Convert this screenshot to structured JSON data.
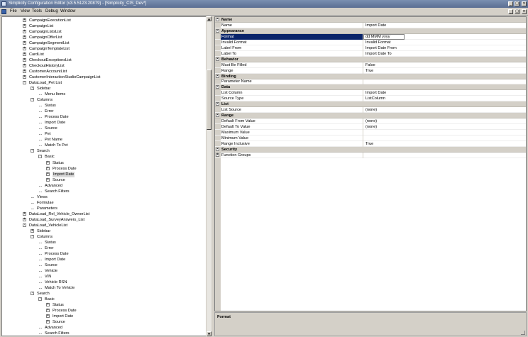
{
  "window": {
    "title": "Simplicity Configuration Editor (v3.5.5123.20879) - [Simplicity_CIS_Dev*]",
    "minimize": "_",
    "restore": "□",
    "close": "×"
  },
  "menu": [
    "File",
    "View",
    "Tools",
    "Debug",
    "Window"
  ],
  "mdi_controls": {
    "minimize": "_",
    "restore": "□",
    "close": "×"
  },
  "tree": [
    {
      "label": "CampaignExecutionList",
      "level": 0,
      "exp": "+"
    },
    {
      "label": "CampaignList",
      "level": 0,
      "exp": "+"
    },
    {
      "label": "CampaignListsList",
      "level": 0,
      "exp": "+"
    },
    {
      "label": "CampaignOfferList",
      "level": 0,
      "exp": "+"
    },
    {
      "label": "CampaignSegmentList",
      "level": 0,
      "exp": "+"
    },
    {
      "label": "CampaignTemplateList",
      "level": 0,
      "exp": "+"
    },
    {
      "label": "CardList",
      "level": 0,
      "exp": "+"
    },
    {
      "label": "CheckoutExceptionsList",
      "level": 0,
      "exp": "+"
    },
    {
      "label": "CheckoutHistoryList",
      "level": 0,
      "exp": "+"
    },
    {
      "label": "CustomerAccountList",
      "level": 0,
      "exp": "+"
    },
    {
      "label": "CustomerInteractionStudioCampaignList",
      "level": 0,
      "exp": "+"
    },
    {
      "label": "DataLoad_Pet List",
      "level": 0,
      "exp": "-"
    },
    {
      "label": "Sidebar",
      "level": 1,
      "exp": "-"
    },
    {
      "label": "Menu Items",
      "level": 2,
      "exp": ""
    },
    {
      "label": "Columns",
      "level": 1,
      "exp": "-"
    },
    {
      "label": "Status",
      "level": 2,
      "exp": ""
    },
    {
      "label": "Error",
      "level": 2,
      "exp": ""
    },
    {
      "label": "Process Date",
      "level": 2,
      "exp": ""
    },
    {
      "label": "Import Date",
      "level": 2,
      "exp": ""
    },
    {
      "label": "Source",
      "level": 2,
      "exp": ""
    },
    {
      "label": "Pet",
      "level": 2,
      "exp": ""
    },
    {
      "label": "Pet Name",
      "level": 2,
      "exp": ""
    },
    {
      "label": "Match To Pet",
      "level": 2,
      "exp": ""
    },
    {
      "label": "Search",
      "level": 1,
      "exp": "-"
    },
    {
      "label": "Basic",
      "level": 2,
      "exp": "-"
    },
    {
      "label": "Status",
      "level": 3,
      "exp": "+"
    },
    {
      "label": "Process Date",
      "level": 3,
      "exp": "+"
    },
    {
      "label": "Import Date",
      "level": 3,
      "exp": "+",
      "selected": true
    },
    {
      "label": "Source",
      "level": 3,
      "exp": "+"
    },
    {
      "label": "Advanced",
      "level": 2,
      "exp": ""
    },
    {
      "label": "Search Filters",
      "level": 2,
      "exp": ""
    },
    {
      "label": "Views",
      "level": 1,
      "exp": ""
    },
    {
      "label": "Formulae",
      "level": 1,
      "exp": ""
    },
    {
      "label": "Parameters",
      "level": 1,
      "exp": ""
    },
    {
      "label": "DataLoad_Rel_Vehicle_OwnerList",
      "level": 0,
      "exp": "+"
    },
    {
      "label": "DataLoad_SurveyAnswers_List",
      "level": 0,
      "exp": "+"
    },
    {
      "label": "DataLoad_VehicleList",
      "level": 0,
      "exp": "-"
    },
    {
      "label": "Sidebar",
      "level": 1,
      "exp": "+"
    },
    {
      "label": "Columns",
      "level": 1,
      "exp": "-"
    },
    {
      "label": "Status",
      "level": 2,
      "exp": ""
    },
    {
      "label": "Error",
      "level": 2,
      "exp": ""
    },
    {
      "label": "Process Date",
      "level": 2,
      "exp": ""
    },
    {
      "label": "Import Date",
      "level": 2,
      "exp": ""
    },
    {
      "label": "Source",
      "level": 2,
      "exp": ""
    },
    {
      "label": "Vehicle",
      "level": 2,
      "exp": ""
    },
    {
      "label": "VIN",
      "level": 2,
      "exp": ""
    },
    {
      "label": "Vehicle RSN",
      "level": 2,
      "exp": ""
    },
    {
      "label": "Match To Vehicle",
      "level": 2,
      "exp": ""
    },
    {
      "label": "Search",
      "level": 1,
      "exp": "-"
    },
    {
      "label": "Basic",
      "level": 2,
      "exp": "-"
    },
    {
      "label": "Status",
      "level": 3,
      "exp": "+"
    },
    {
      "label": "Process Date",
      "level": 3,
      "exp": "+"
    },
    {
      "label": "Import Date",
      "level": 3,
      "exp": "+"
    },
    {
      "label": "Source",
      "level": 3,
      "exp": "+"
    },
    {
      "label": "Advanced",
      "level": 2,
      "exp": ""
    },
    {
      "label": "Search Filters",
      "level": 2,
      "exp": ""
    }
  ],
  "properties": [
    {
      "cat": true,
      "name": "Name",
      "exp": "-"
    },
    {
      "name": "Name",
      "value": "Import Date"
    },
    {
      "cat": true,
      "name": "Appearance",
      "exp": "-"
    },
    {
      "name": "Format",
      "value": "dd MMM yyyy",
      "selected": true
    },
    {
      "name": "Invalid Format",
      "value": "Invalid Format"
    },
    {
      "name": "Label From",
      "value": "Import Date From"
    },
    {
      "name": "Label To",
      "value": "Import Date To"
    },
    {
      "cat": true,
      "name": "Behavior",
      "exp": "-"
    },
    {
      "name": "Must Be Filled",
      "value": "False"
    },
    {
      "name": "Range",
      "value": "True"
    },
    {
      "cat": true,
      "name": "Binding",
      "exp": "-"
    },
    {
      "name": "Parameter Name",
      "value": ""
    },
    {
      "cat": true,
      "name": "Data",
      "exp": "-"
    },
    {
      "name": "List Column",
      "value": "Import Date"
    },
    {
      "name": "Source Type",
      "value": "ListColumn"
    },
    {
      "cat": true,
      "name": "List",
      "exp": "-"
    },
    {
      "name": "List Source",
      "value": "(none)"
    },
    {
      "cat": true,
      "name": "Range",
      "exp": "-"
    },
    {
      "name": "Default From Value",
      "value": "(none)"
    },
    {
      "name": "Default To Value",
      "value": "(none)"
    },
    {
      "name": "Maximum Value",
      "value": ""
    },
    {
      "name": "Minimum Value",
      "value": ""
    },
    {
      "name": "Range Inclusive",
      "value": "True"
    },
    {
      "cat": true,
      "name": "Security",
      "exp": "-"
    },
    {
      "name": "Function Groups",
      "value": "",
      "exp": "+"
    }
  ],
  "description": {
    "title": "Format"
  }
}
